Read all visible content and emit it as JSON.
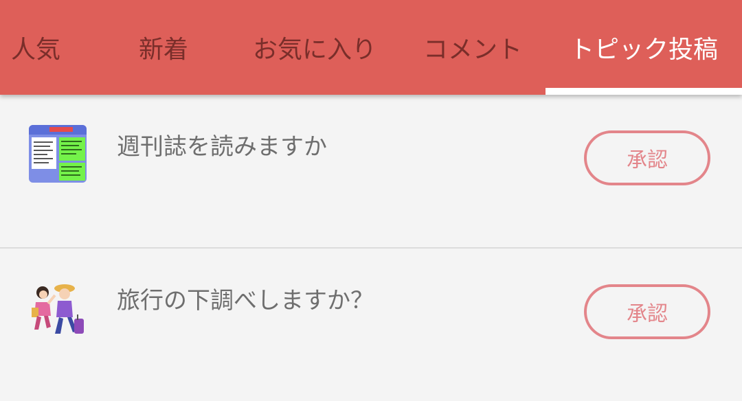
{
  "tabs": [
    {
      "label": "人気",
      "active": false
    },
    {
      "label": "新着",
      "active": false
    },
    {
      "label": "お気に入り",
      "active": false
    },
    {
      "label": "コメント",
      "active": false
    },
    {
      "label": "トピック投稿",
      "active": true
    }
  ],
  "topics": [
    {
      "title": "週刊誌を読みますか",
      "action_label": "承認",
      "thumbnail": "magazine-thumbnail"
    },
    {
      "title": "旅行の下調べしますか？",
      "action_label": "承認",
      "thumbnail": "travelers-illustration"
    }
  ],
  "colors": {
    "header": "#de5f59",
    "tab_inactive_text": "#7a2e2a",
    "tab_active_text": "#ffffff",
    "approve_accent": "#e3858a",
    "background": "#f4f4f4"
  }
}
